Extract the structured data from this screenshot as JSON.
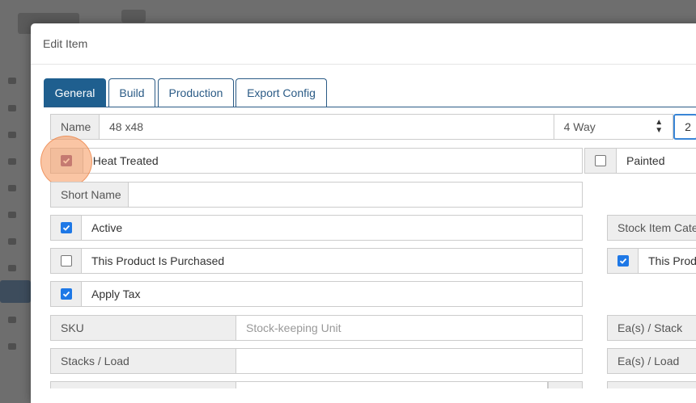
{
  "modal": {
    "title": "Edit Item"
  },
  "tabs": [
    {
      "label": "General",
      "active": true
    },
    {
      "label": "Build",
      "active": false
    },
    {
      "label": "Production",
      "active": false
    },
    {
      "label": "Export Config",
      "active": false
    }
  ],
  "form": {
    "name": {
      "label": "Name",
      "value": "48 x48"
    },
    "way_select": {
      "value": "4 Way"
    },
    "extra_input": {
      "value": "2"
    },
    "heat_treated": {
      "label": "Heat Treated",
      "checked": true
    },
    "painted": {
      "label": "Painted",
      "checked": false
    },
    "short_name": {
      "label": "Short Name",
      "value": ""
    },
    "active": {
      "label": "Active",
      "checked": true
    },
    "stock_item_category": {
      "label": "Stock Item Categ"
    },
    "purchased": {
      "label": "This Product Is Purchased",
      "checked": false
    },
    "produced": {
      "label": "This Produ",
      "checked": true
    },
    "apply_tax": {
      "label": "Apply Tax",
      "checked": true
    },
    "sku": {
      "label": "SKU",
      "placeholder": "Stock-keeping Unit"
    },
    "ea_stack": {
      "label": "Ea(s) / Stack"
    },
    "stacks_load": {
      "label": "Stacks / Load",
      "value": ""
    },
    "ea_load": {
      "label": "Ea(s) / Load"
    }
  },
  "colors": {
    "primary": "#1f5f8f",
    "checkbox_checked": "#1e78e6",
    "checkbox_highlighted": "#8a5a8f",
    "click_highlight": "#f6965a"
  }
}
